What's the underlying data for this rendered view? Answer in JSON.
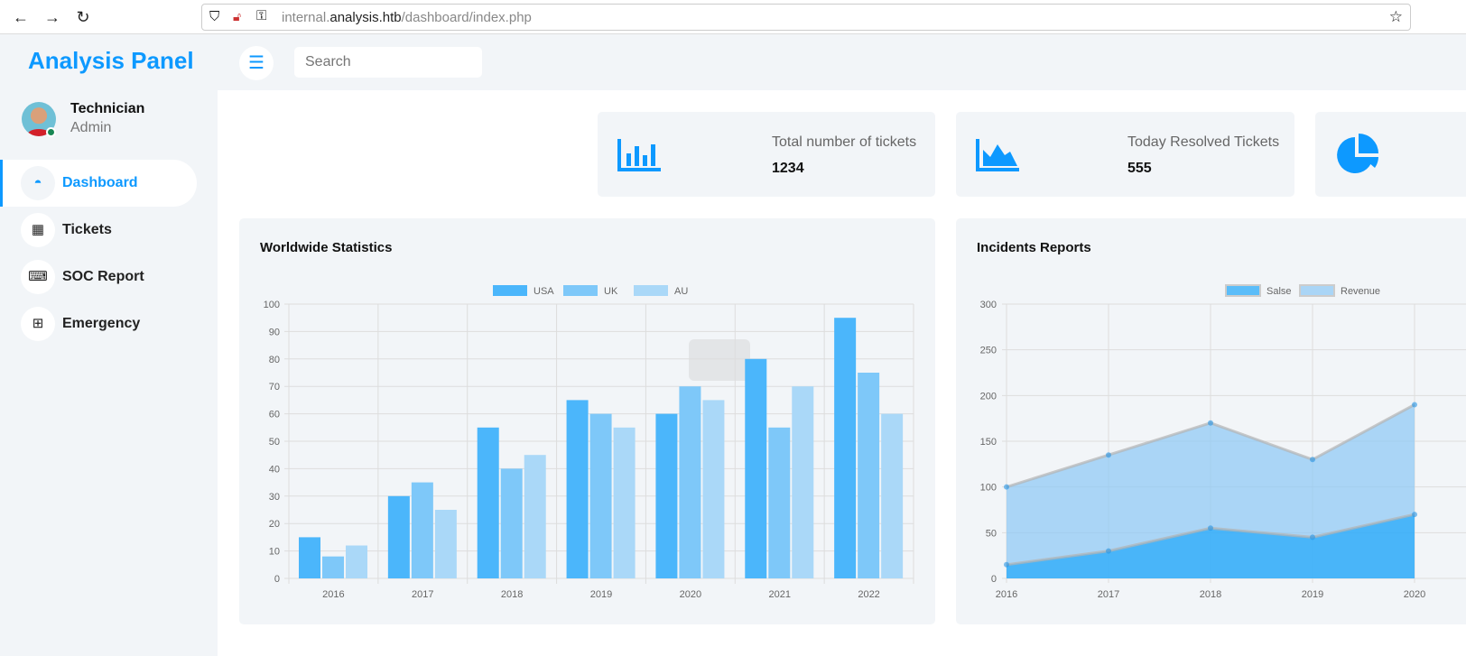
{
  "browser": {
    "url_prefix": "internal.",
    "url_domain": "analysis.htb",
    "url_path": "/dashboard/index.php"
  },
  "brand": "Analysis Panel",
  "search": {
    "placeholder": "Search"
  },
  "user": {
    "name": "Technician",
    "role": "Admin",
    "status_color": "#198754"
  },
  "sidebar": {
    "items": [
      {
        "label": "Dashboard",
        "icon": "gauge-icon",
        "active": true
      },
      {
        "label": "Tickets",
        "icon": "grid-icon"
      },
      {
        "label": "SOC Report",
        "icon": "keyboard-icon"
      },
      {
        "label": "Emergency",
        "icon": "table-icon"
      }
    ]
  },
  "stats": [
    {
      "title": "Total number of tickets",
      "value": "1234",
      "icon": "bar-chart-icon"
    },
    {
      "title": "Today Resolved Tickets",
      "value": "555",
      "icon": "area-chart-icon"
    },
    {
      "title": "",
      "value": "",
      "icon": "pie-chart-icon"
    }
  ],
  "colors": {
    "accent": "#0d99ff",
    "usa": "#4bb6fb",
    "uk": "#7ec8f9",
    "au": "#aad8f8"
  },
  "worldwide": {
    "title": "Worldwide Statistics"
  },
  "incidents": {
    "title": "Incidents Reports"
  },
  "chart_data": [
    {
      "type": "bar",
      "title": "Worldwide Statistics",
      "categories": [
        "2016",
        "2017",
        "2018",
        "2019",
        "2020",
        "2021",
        "2022"
      ],
      "series": [
        {
          "name": "USA",
          "values": [
            15,
            30,
            55,
            65,
            60,
            80,
            95
          ]
        },
        {
          "name": "UK",
          "values": [
            8,
            35,
            40,
            60,
            70,
            55,
            75
          ]
        },
        {
          "name": "AU",
          "values": [
            12,
            25,
            45,
            55,
            65,
            70,
            60
          ]
        }
      ],
      "ylim": [
        0,
        100
      ],
      "yticks": [
        0,
        10,
        20,
        30,
        40,
        50,
        60,
        70,
        80,
        90,
        100
      ],
      "grid": true,
      "legend": "top"
    },
    {
      "type": "area",
      "title": "Incidents Reports",
      "categories": [
        "2016",
        "2017",
        "2018",
        "2019",
        "2020"
      ],
      "series": [
        {
          "name": "Salse",
          "values": [
            15,
            30,
            55,
            45,
            70
          ]
        },
        {
          "name": "Revenue",
          "values": [
            100,
            135,
            170,
            130,
            190
          ]
        }
      ],
      "ylim": [
        0,
        300
      ],
      "yticks": [
        0,
        50,
        100,
        150,
        200,
        250,
        300
      ],
      "grid": true,
      "legend": "top"
    }
  ]
}
